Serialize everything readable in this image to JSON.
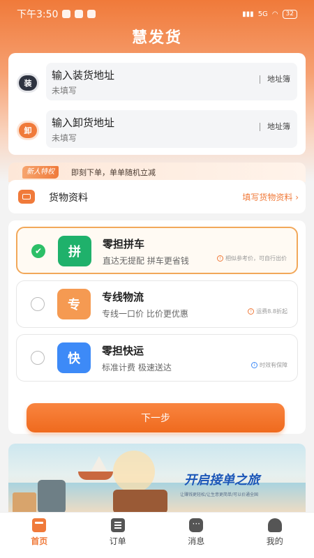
{
  "status_bar": {
    "time": "下午3:50",
    "network": "5G",
    "battery": "32"
  },
  "app_title": "慧发货",
  "address": {
    "load": {
      "badge": "装",
      "title": "输入装货地址",
      "status": "未填写",
      "book": "地址簿"
    },
    "unload": {
      "badge": "卸",
      "title": "输入卸货地址",
      "status": "未填写",
      "book": "地址簿"
    }
  },
  "promo": {
    "tag": "新人特权",
    "text": "即刻下单，单单随机立减"
  },
  "cargo": {
    "label": "货物资料",
    "link": "填写货物资料 ›"
  },
  "options": [
    {
      "icon_char": "拼",
      "title": "零担拼车",
      "desc": "直达无提配 拼车更省钱",
      "note": "相似参考价，可自行出价",
      "selected": true
    },
    {
      "icon_char": "专",
      "title": "专线物流",
      "desc": "专线一口价 比价更优惠",
      "note": "运费8.8折起",
      "selected": false
    },
    {
      "icon_char": "快",
      "title": "零担快运",
      "desc": "标准计费 极速送达",
      "note": "时效有保障",
      "selected": false
    }
  ],
  "next_button": "下一步",
  "banner": {
    "title": "开启接单之旅",
    "subtitle": "让赚钱更轻松/让生意更简单/可以价通全国"
  },
  "tabbar": [
    {
      "label": "首页",
      "icon": "home-icon",
      "active": true
    },
    {
      "label": "订单",
      "icon": "order-icon",
      "active": false
    },
    {
      "label": "消息",
      "icon": "message-icon",
      "active": false
    },
    {
      "label": "我的",
      "icon": "profile-icon",
      "active": false
    }
  ],
  "colors": {
    "accent": "#f07a3a",
    "green": "#1fb16b",
    "orange": "#f59a52",
    "blue": "#3d8af7"
  }
}
